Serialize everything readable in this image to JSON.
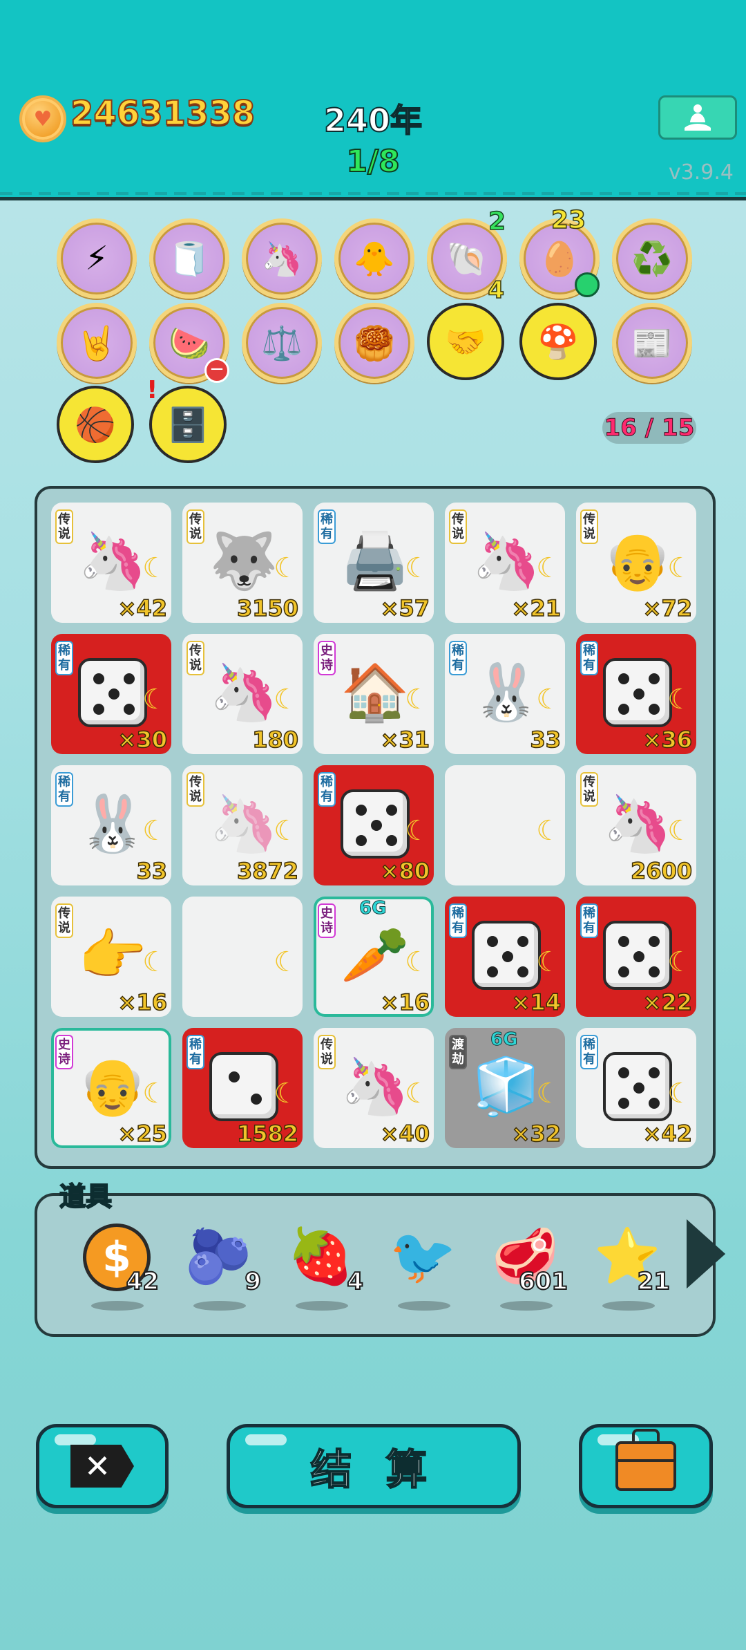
{
  "header": {
    "coins": "24631338",
    "year": "240年",
    "progress": "1/8",
    "version": "v3.9.4"
  },
  "relics": [
    {
      "name": "lightning",
      "glyph": "⚡",
      "style": "purple"
    },
    {
      "name": "tissue-box",
      "glyph": "🧻",
      "style": "purple"
    },
    {
      "name": "unicorn-card",
      "glyph": "🦄",
      "style": "purple"
    },
    {
      "name": "chick-sword",
      "glyph": "🐥",
      "style": "purple"
    },
    {
      "name": "shell",
      "glyph": "🐚",
      "style": "purple",
      "top_badge": "2",
      "bottom_badge": "4"
    },
    {
      "name": "egg-carton",
      "glyph": "🥚",
      "style": "purple",
      "top_badge": "23",
      "green_dot": true
    },
    {
      "name": "recycle",
      "glyph": "♻️",
      "style": "purple"
    },
    {
      "name": "rock-hand",
      "glyph": "🤘",
      "style": "purple"
    },
    {
      "name": "fruit-bowl",
      "glyph": "🍉",
      "style": "purple",
      "minus": true
    },
    {
      "name": "scales",
      "glyph": "⚖️",
      "style": "purple"
    },
    {
      "name": "mooncake",
      "glyph": "🥮",
      "style": "purple"
    },
    {
      "name": "handshake",
      "glyph": "🤝",
      "style": "yellow"
    },
    {
      "name": "mushroom-cloud",
      "glyph": "🍄",
      "style": "yellow"
    },
    {
      "name": "time-magazine",
      "glyph": "📰",
      "style": "purple"
    },
    {
      "name": "basketballs",
      "glyph": "🏀",
      "style": "yellow"
    },
    {
      "name": "safe",
      "glyph": "🗄️",
      "style": "yellow",
      "exclaim": true
    }
  ],
  "slot_counter": "16 / 15",
  "rarity": {
    "legend": "传说",
    "rare": "稀有",
    "epic": "史诗",
    "tribulation": "渡劫"
  },
  "board": [
    [
      {
        "rarity": "legend",
        "art": "unicorn",
        "value": "×42"
      },
      {
        "rarity": "legend",
        "art": "husky-king",
        "value": "3150"
      },
      {
        "rarity": "rare",
        "art": "printer",
        "value": "×57"
      },
      {
        "rarity": "legend",
        "art": "unicorn",
        "value": "×21"
      },
      {
        "rarity": "legend",
        "art": "old-man-glasses",
        "value": "×72"
      }
    ],
    [
      {
        "rarity": "rare",
        "art": "dice5",
        "bg": "red",
        "value": "×30"
      },
      {
        "rarity": "legend",
        "art": "unicorn",
        "value": "180"
      },
      {
        "rarity": "epic",
        "art": "rabbit-house",
        "value": "×31"
      },
      {
        "rarity": "rare",
        "art": "rabbit",
        "value": "33"
      },
      {
        "rarity": "rare",
        "art": "dice5",
        "bg": "red",
        "value": "×36"
      }
    ],
    [
      {
        "rarity": "rare",
        "art": "rabbit",
        "value": "33"
      },
      {
        "rarity": "legend",
        "art": "unicorn-ghost",
        "value": "3872"
      },
      {
        "rarity": "rare",
        "art": "dice5",
        "bg": "red",
        "value": "×80"
      },
      {
        "rarity": "",
        "art": "empty",
        "value": ""
      },
      {
        "rarity": "legend",
        "art": "unicorn",
        "value": "2600"
      }
    ],
    [
      {
        "rarity": "legend",
        "art": "pointing-hand",
        "value": "×16"
      },
      {
        "rarity": "",
        "art": "empty",
        "value": ""
      },
      {
        "rarity": "epic",
        "art": "carrot",
        "value": "×16",
        "sixg": "6G",
        "selected": true
      },
      {
        "rarity": "rare",
        "art": "dice5",
        "bg": "red",
        "value": "×14"
      },
      {
        "rarity": "rare",
        "art": "dice5",
        "bg": "red",
        "value": "×22"
      }
    ],
    [
      {
        "rarity": "epic",
        "art": "old-man",
        "value": "×25",
        "selected": true
      },
      {
        "rarity": "rare",
        "art": "dice2",
        "bg": "red",
        "value": "1582"
      },
      {
        "rarity": "legend",
        "art": "unicorn",
        "value": "×40"
      },
      {
        "rarity": "tribulation",
        "art": "fridge",
        "bg": "grey",
        "value": "×32",
        "sixg": "6G"
      },
      {
        "rarity": "rare",
        "art": "dice5",
        "value": "×42"
      }
    ]
  ],
  "items_label": "道具",
  "items": [
    {
      "name": "coin",
      "glyph": "💲",
      "count": "42"
    },
    {
      "name": "blueberry",
      "glyph": "🫐",
      "count": "9"
    },
    {
      "name": "strawberry",
      "glyph": "🍓",
      "count": "4"
    },
    {
      "name": "white-bird",
      "glyph": "🐦",
      "count": ""
    },
    {
      "name": "liver",
      "glyph": "🥩",
      "count": "601"
    },
    {
      "name": "star",
      "glyph": "⭐",
      "count": "21"
    }
  ],
  "buttons": {
    "settle": "结 算"
  },
  "colors": {
    "header": "#13c4c3",
    "coin_text": "#ffd33a",
    "progress": "#2ee85a",
    "cell_red": "#d6201f"
  }
}
